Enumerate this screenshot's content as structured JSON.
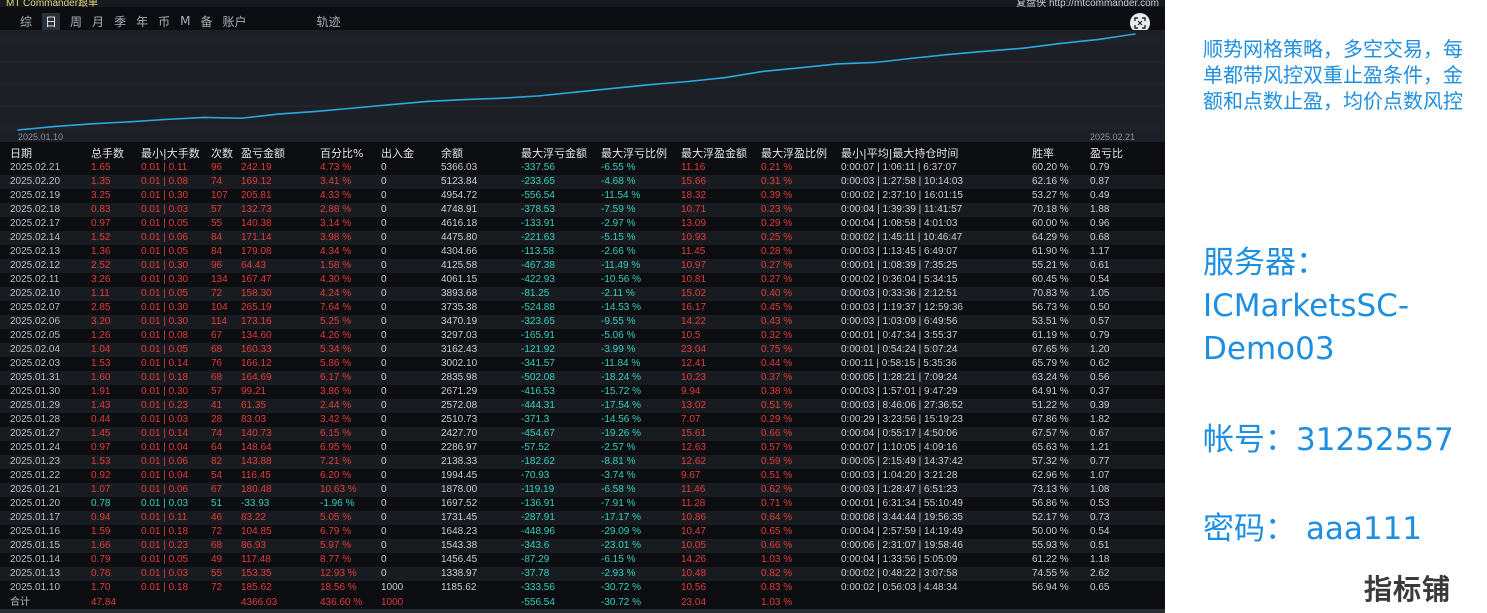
{
  "header": {
    "brand_left": "MT Commander跟单",
    "brand_right": "复盘侠 http://mtcommander.com"
  },
  "tabs": [
    "综",
    "日",
    "周",
    "月",
    "季",
    "年",
    "币",
    "M",
    "备",
    "账户",
    "轨迹"
  ],
  "selected_tab": "日",
  "chart": {
    "x_start": "2025.01.10",
    "x_end": "2025.02.21",
    "line_color": "#2aa9df"
  },
  "chart_data": {
    "type": "line",
    "x": [
      "2025.01.10",
      "2025.01.13",
      "2025.01.14",
      "2025.01.15",
      "2025.01.16",
      "2025.01.17",
      "2025.01.20",
      "2025.01.21",
      "2025.01.22",
      "2025.01.23",
      "2025.01.24",
      "2025.01.27",
      "2025.01.28",
      "2025.01.29",
      "2025.01.30",
      "2025.01.31",
      "2025.02.03",
      "2025.02.04",
      "2025.02.05",
      "2025.02.06",
      "2025.02.07",
      "2025.02.10",
      "2025.02.11",
      "2025.02.12",
      "2025.02.13",
      "2025.02.14",
      "2025.02.17",
      "2025.02.18",
      "2025.02.19",
      "2025.02.20",
      "2025.02.21"
    ],
    "y": [
      1185.62,
      1338.97,
      1456.45,
      1543.38,
      1648.23,
      1731.45,
      1697.52,
      1878.0,
      1994.45,
      2138.33,
      2286.97,
      2427.7,
      2510.73,
      2572.08,
      2671.29,
      2835.98,
      3002.1,
      3162.43,
      3297.03,
      3470.19,
      3735.38,
      3893.68,
      4061.15,
      4125.58,
      4304.66,
      4475.8,
      4616.18,
      4748.91,
      4954.72,
      5123.84,
      5366.03
    ]
  },
  "table": {
    "headers": [
      "日期",
      "总手数",
      "最小|大手数",
      "次数",
      "盈亏金额",
      "百分比%",
      "出入金",
      "余额",
      "最大浮亏金额",
      "最大浮亏比例",
      "最大浮盈金额",
      "最大浮盈比例",
      "最小|平均|最大持仓时间",
      "胜率",
      "盈亏比"
    ],
    "rows": [
      [
        "2025.02.21",
        "1.65",
        "0.01 | 0.11",
        "96",
        "242.19",
        "4.73 %",
        "0",
        "5366.03",
        "-337.56",
        "-6.55 %",
        "11.16",
        "0.21 %",
        "0:00:07 | 1:06:11 | 6:37:07",
        "60.20 %",
        "0.79"
      ],
      [
        "2025.02.20",
        "1.35",
        "0.01 | 0.08",
        "74",
        "169.12",
        "3.41 %",
        "0",
        "5123.84",
        "-233.65",
        "-4.68 %",
        "15.66",
        "0.31 %",
        "0:00:03 | 1:27:58 | 10:14:03",
        "62.16 %",
        "0.87"
      ],
      [
        "2025.02.19",
        "3.25",
        "0.01 | 0.30",
        "107",
        "205.81",
        "4.33 %",
        "0",
        "4954.72",
        "-556.54",
        "-11.54 %",
        "18.32",
        "0.39 %",
        "0:00:02 | 2:37:10 | 16:01:15",
        "53.27 %",
        "0.49"
      ],
      [
        "2025.02.18",
        "0.83",
        "0.01 | 0.03",
        "57",
        "132.73",
        "2.88 %",
        "0",
        "4748.91",
        "-378.53",
        "-7.59 %",
        "10.71",
        "0.23 %",
        "0:00:04 | 1:39:39 | 11:41:57",
        "70.18 %",
        "1.88"
      ],
      [
        "2025.02.17",
        "0.97",
        "0.01 | 0.05",
        "55",
        "140.38",
        "3.14 %",
        "0",
        "4616.18",
        "-133.91",
        "-2.97 %",
        "13.09",
        "0.29 %",
        "0:00:04 | 1:08:58 | 4:01:03",
        "60.00 %",
        "0.96"
      ],
      [
        "2025.02.14",
        "1.52",
        "0.01 | 0.06",
        "84",
        "171.14",
        "3.98 %",
        "0",
        "4475.80",
        "-221.63",
        "-5.15 %",
        "10.93",
        "0.25 %",
        "0:00:02 | 1:45:11 | 10:46:47",
        "64.29 %",
        "0.68"
      ],
      [
        "2025.02.13",
        "1.36",
        "0.01 | 0.05",
        "84",
        "179.08",
        "4.34 %",
        "0",
        "4304.66",
        "-113.58",
        "-2.66 %",
        "11.45",
        "0.28 %",
        "0:00:03 | 1:13:45 | 6:49:07",
        "61.90 %",
        "1.17"
      ],
      [
        "2025.02.12",
        "2.52",
        "0.01 | 0.30",
        "96",
        "64.43",
        "1.58 %",
        "0",
        "4125.58",
        "-467.38",
        "-11.49 %",
        "10.97",
        "0.27 %",
        "0:00:01 | 1:08:39 | 7:35:25",
        "55.21 %",
        "0.61"
      ],
      [
        "2025.02.11",
        "3.26",
        "0.01 | 0.30",
        "134",
        "167.47",
        "4.30 %",
        "0",
        "4061.15",
        "-422.93",
        "-10.56 %",
        "10.81",
        "0.27 %",
        "0:00:02 | 0:36:04 | 5:34:15",
        "60.45 %",
        "0.54"
      ],
      [
        "2025.02.10",
        "1.11",
        "0.01 | 0.05",
        "72",
        "158.30",
        "4.24 %",
        "0",
        "3893.68",
        "-81.25",
        "-2.11 %",
        "15.02",
        "0.40 %",
        "0:00:03 | 0:33:36 | 2:12:51",
        "70.83 %",
        "1.05"
      ],
      [
        "2025.02.07",
        "2.85",
        "0.01 | 0.30",
        "104",
        "265.19",
        "7.64 %",
        "0",
        "3735.38",
        "-524.88",
        "-14.53 %",
        "16.17",
        "0.45 %",
        "0:00:03 | 1:19:37 | 12:59:36",
        "56.73 %",
        "0.50"
      ],
      [
        "2025.02.06",
        "3.20",
        "0.01 | 0.30",
        "114",
        "173.16",
        "5.25 %",
        "0",
        "3470.19",
        "-323.65",
        "-9.55 %",
        "14.22",
        "0.43 %",
        "0:00:03 | 1:03:09 | 6:49:56",
        "53.51 %",
        "0.57"
      ],
      [
        "2025.02.05",
        "1.26",
        "0.01 | 0.08",
        "67",
        "134.60",
        "4.26 %",
        "0",
        "3297.03",
        "-165.91",
        "-5.06 %",
        "10.5",
        "0.32 %",
        "0:00:01 | 0:47:34 | 3:55:37",
        "61.19 %",
        "0.79"
      ],
      [
        "2025.02.04",
        "1.04",
        "0.01 | 0.05",
        "68",
        "160.33",
        "5.34 %",
        "0",
        "3162.43",
        "-121.92",
        "-3.99 %",
        "23.04",
        "0.75 %",
        "0:00:01 | 0:54:24 | 5:07:24",
        "67.65 %",
        "1.20"
      ],
      [
        "2025.02.03",
        "1.53",
        "0.01 | 0.14",
        "76",
        "166.12",
        "5.86 %",
        "0",
        "3002.10",
        "-341.57",
        "-11.84 %",
        "12.41",
        "0.44 %",
        "0:00:11 | 0:58:15 | 5:35:36",
        "65.79 %",
        "0.62"
      ],
      [
        "2025.01.31",
        "1.60",
        "0.01 | 0.18",
        "68",
        "164.69",
        "6.17 %",
        "0",
        "2835.98",
        "-502.08",
        "-18.24 %",
        "10.23",
        "0.37 %",
        "0:00:05 | 1:28:21 | 7:09:24",
        "63.24 %",
        "0.56"
      ],
      [
        "2025.01.30",
        "1.91",
        "0.01 | 0.30",
        "57",
        "99.21",
        "3.86 %",
        "0",
        "2671.29",
        "-416.53",
        "-15.72 %",
        "9.94",
        "0.38 %",
        "0:00:03 | 1:57:01 | 9:47:29",
        "64.91 %",
        "0.37"
      ],
      [
        "2025.01.29",
        "1.43",
        "0.01 | 0.23",
        "41",
        "61.35",
        "2.44 %",
        "0",
        "2572.08",
        "-444.31",
        "-17.54 %",
        "13.02",
        "0.51 %",
        "0:00:03 | 8:46:06 | 27:36:52",
        "51.22 %",
        "0.39"
      ],
      [
        "2025.01.28",
        "0.44",
        "0.01 | 0.03",
        "28",
        "83.03",
        "3.42 %",
        "0",
        "2510.73",
        "-371.3",
        "-14.56 %",
        "7.07",
        "0.29 %",
        "0:00:29 | 3:23:56 | 15:19:23",
        "67.86 %",
        "1.82"
      ],
      [
        "2025.01.27",
        "1.45",
        "0.01 | 0.14",
        "74",
        "140.73",
        "6.15 %",
        "0",
        "2427.70",
        "-454.67",
        "-19.26 %",
        "15.61",
        "0.66 %",
        "0:00:04 | 0:55:17 | 4:50:06",
        "67.57 %",
        "0.67"
      ],
      [
        "2025.01.24",
        "0.97",
        "0.01 | 0.04",
        "64",
        "148.64",
        "6.95 %",
        "0",
        "2286.97",
        "-57.52",
        "-2.57 %",
        "12.63",
        "0.57 %",
        "0:00:07 | 1:10:05 | 4:09:16",
        "65.63 %",
        "1.21"
      ],
      [
        "2025.01.23",
        "1.53",
        "0.01 | 0.06",
        "82",
        "143.88",
        "7.21 %",
        "0",
        "2138.33",
        "-182.62",
        "-8.81 %",
        "12.62",
        "0.59 %",
        "0:00:05 | 2:15:49 | 14:37:42",
        "57.32 %",
        "0.77"
      ],
      [
        "2025.01.22",
        "0.92",
        "0.01 | 0.04",
        "54",
        "116.45",
        "6.20 %",
        "0",
        "1994.45",
        "-70.93",
        "-3.74 %",
        "9.67",
        "0.51 %",
        "0:00:03 | 1:04:20 | 3:21:28",
        "62.96 %",
        "1.07"
      ],
      [
        "2025.01.21",
        "1.07",
        "0.01 | 0.06",
        "67",
        "180.48",
        "10.63 %",
        "0",
        "1878.00",
        "-119.19",
        "-6.58 %",
        "11.46",
        "0.62 %",
        "0:00:03 | 1:28:47 | 6:51:23",
        "73.13 %",
        "1.08"
      ],
      [
        "2025.01.20",
        "0.78",
        "0.01 | 0.03",
        "51",
        "-33.93",
        "-1.96 %",
        "0",
        "1697.52",
        "-136.91",
        "-7.91 %",
        "11.28",
        "0.71 %",
        "0:00:01 | 6:31:34 | 55:10:49",
        "56.86 %",
        "0.53"
      ],
      [
        "2025.01.17",
        "0.94",
        "0.01 | 0.11",
        "46",
        "83.22",
        "5.05 %",
        "0",
        "1731.45",
        "-287.91",
        "-17.17 %",
        "10.86",
        "0.64 %",
        "0:00:08 | 3:44:44 | 19:56:35",
        "52.17 %",
        "0.73"
      ],
      [
        "2025.01.16",
        "1.59",
        "0.01 | 0.18",
        "72",
        "104.85",
        "6.79 %",
        "0",
        "1648.23",
        "-448.96",
        "-29.09 %",
        "10.47",
        "0.65 %",
        "0:00:04 | 2:57:59 | 14:19:49",
        "50.00 %",
        "0.54"
      ],
      [
        "2025.01.15",
        "1.66",
        "0.01 | 0.23",
        "68",
        "86.93",
        "5.97 %",
        "0",
        "1543.38",
        "-343.6",
        "-23.01 %",
        "10.05",
        "0.66 %",
        "0:00:06 | 2:31:07 | 19:58:46",
        "55.93 %",
        "0.51"
      ],
      [
        "2025.01.14",
        "0.79",
        "0.01 | 0.05",
        "49",
        "117.48",
        "8.77 %",
        "0",
        "1456.45",
        "-87.29",
        "-6.15 %",
        "14.26",
        "1.03 %",
        "0:00:04 | 1:33:56 | 5:05:09",
        "61.22 %",
        "1.18"
      ],
      [
        "2025.01.13",
        "0.76",
        "0.01 | 0.03",
        "55",
        "153.35",
        "12.93 %",
        "0",
        "1338.97",
        "-37.78",
        "-2.93 %",
        "10.48",
        "0.82 %",
        "0:00:02 | 0:48:22 | 3:07:58",
        "74.55 %",
        "2.62"
      ],
      [
        "2025.01.10",
        "1.70",
        "0.01 | 0.18",
        "72",
        "185.62",
        "18.56 %",
        "1000",
        "1185.62",
        "-333.56",
        "-30.72 %",
        "10.56",
        "0.83 %",
        "0:00:02 | 0:56:03 | 4:48:34",
        "56.94 %",
        "0.65"
      ]
    ],
    "totals": [
      "合计",
      "47.84",
      "",
      "",
      "4366.03",
      "436.60 %",
      "1000",
      "",
      "-556.54",
      "-30.72 %",
      "23.04",
      "1.03 %",
      "",
      "",
      ""
    ]
  },
  "sidebar": {
    "description": "顺势网格策略，多空交易，每单都带风控双重止盈条件，金额和点数止盈，均价点数风控",
    "server_label": "服务器：",
    "server_name": "ICMarketsSC-Demo03",
    "account": "帐号：31252557",
    "password": "密码： aaa111"
  },
  "watermark": "指标铺"
}
